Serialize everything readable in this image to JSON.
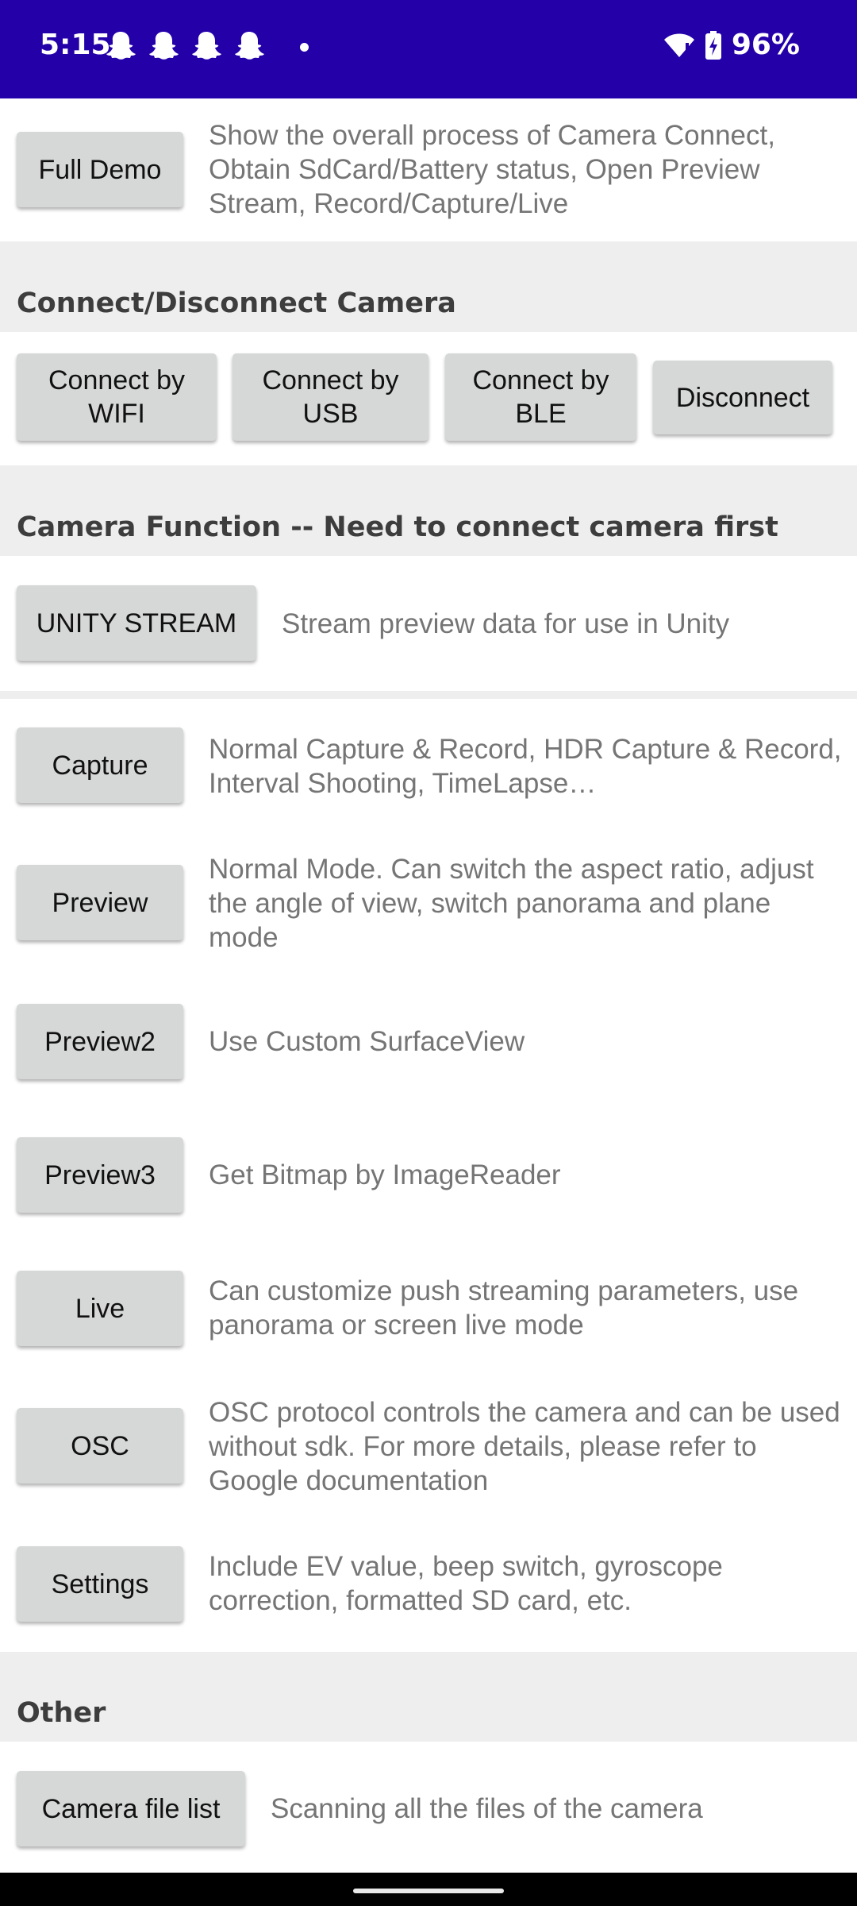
{
  "status_bar": {
    "time": "5:15",
    "battery": "96%",
    "notification_icons": [
      "snapchat-icon",
      "snapchat-icon",
      "snapchat-icon",
      "snapchat-icon"
    ]
  },
  "demo": {
    "button": "Full Demo",
    "desc": "Show the overall process of Camera Connect, Obtain SdCard/Battery status, Open Preview Stream, Record/Capture/Live"
  },
  "connect_section": {
    "title": "Connect/Disconnect Camera",
    "wifi": "Connect by\nWIFI",
    "usb": "Connect by\nUSB",
    "ble": "Connect by\nBLE",
    "disconnect": "Disconnect"
  },
  "function_section": {
    "title": "Camera Function -- Need to connect camera first",
    "unity_button": "UNITY STREAM",
    "unity_desc": "Stream preview data for use in Unity",
    "items": [
      {
        "button": "Capture",
        "desc": "Normal Capture & Record, HDR Capture & Record, Interval Shooting, TimeLapse…"
      },
      {
        "button": "Preview",
        "desc": "Normal Mode. Can switch the aspect ratio, adjust the angle of view, switch panorama and plane mode"
      },
      {
        "button": "Preview2",
        "desc": "Use Custom SurfaceView"
      },
      {
        "button": "Preview3",
        "desc": "Get Bitmap by ImageReader"
      },
      {
        "button": "Live",
        "desc": "Can customize push streaming parameters, use panorama or screen live mode"
      },
      {
        "button": "OSC",
        "desc": "OSC protocol controls the camera and can be used without sdk. For more details, please refer to Google documentation"
      },
      {
        "button": "Settings",
        "desc": "Include EV value, beep switch, gyroscope correction, formatted SD card, etc."
      }
    ]
  },
  "other_section": {
    "title": "Other",
    "button": "Camera file list",
    "desc": "Scanning all the files of the camera"
  }
}
